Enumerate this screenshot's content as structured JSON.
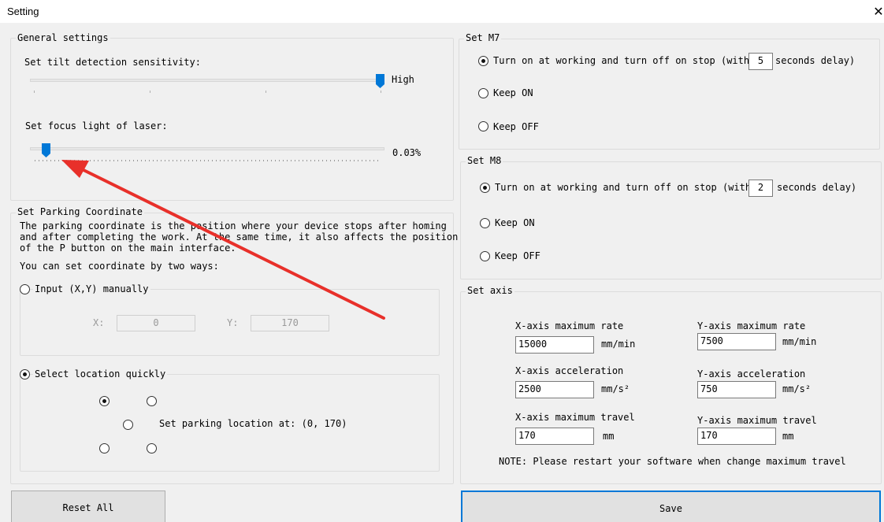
{
  "window": {
    "title": "Setting",
    "close_glyph": "✕"
  },
  "general": {
    "legend": "General settings",
    "tilt_label": "Set tilt detection sensitivity:",
    "tilt_value_label": "High",
    "tilt_level": 1.0,
    "focus_label": "Set focus light of laser:",
    "focus_value_label": "0.03%",
    "focus_level": 0.03
  },
  "parking": {
    "legend": "Set Parking Coordinate",
    "desc_line1": "The parking coordinate is the position where your device stops after homing",
    "desc_line2": "and after completing the work. At the same time, it also affects the position",
    "desc_line3": "of the P button on the main interface.",
    "ways_label": "You can set coordinate by two ways:",
    "manual_label": "Input (X,Y) manually",
    "manual_selected": false,
    "x_label": "X:",
    "x_value": "0",
    "y_label": "Y:",
    "y_value": "170",
    "quick_label": "Select location quickly",
    "quick_selected": true,
    "location_text": "Set parking location at: (0, 170)"
  },
  "m7": {
    "legend": "Set M7",
    "opt1_before": "Turn on at working and turn off on stop (with",
    "opt1_delay": "5",
    "opt1_after": "seconds delay)",
    "opt2": "Keep ON",
    "opt3": "Keep OFF",
    "selected": "opt1"
  },
  "m8": {
    "legend": "Set M8",
    "opt1_before": "Turn on at working and turn off on stop (with",
    "opt1_delay": "2",
    "opt1_after": "seconds delay)",
    "opt2": "Keep ON",
    "opt3": "Keep OFF",
    "selected": "opt1"
  },
  "axis": {
    "legend": "Set axis",
    "x_rate_label": "X-axis maximum rate",
    "x_rate": "15000",
    "x_rate_unit": "mm/min",
    "y_rate_label": "Y-axis maximum rate",
    "y_rate": "7500",
    "y_rate_unit": "mm/min",
    "x_acc_label": "X-axis acceleration",
    "x_acc": "2500",
    "x_acc_unit": "mm/s²",
    "y_acc_label": "Y-axis acceleration",
    "y_acc": "750",
    "y_acc_unit": "mm/s²",
    "x_travel_label": "X-axis maximum travel",
    "x_travel": "170",
    "x_travel_unit": "mm",
    "y_travel_label": "Y-axis maximum travel",
    "y_travel": "170",
    "y_travel_unit": "mm",
    "note": "NOTE: Please restart your software when change maximum travel"
  },
  "buttons": {
    "reset": "Reset All",
    "save": "Save"
  },
  "colors": {
    "accent": "#0078d7",
    "annotation_arrow": "#e8302a"
  },
  "icons": {
    "close": "close-icon",
    "slider_thumb": "slider-thumb-icon"
  }
}
